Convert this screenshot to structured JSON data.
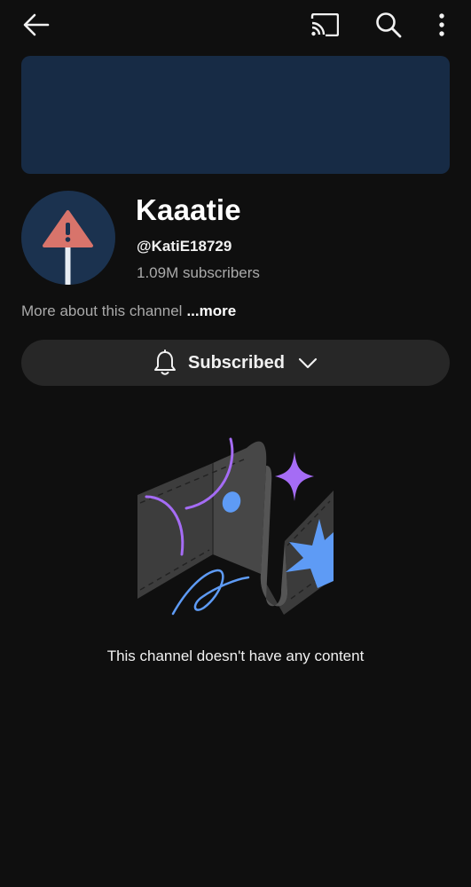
{
  "topbar": {
    "back_icon": "arrow-left-icon",
    "cast_icon": "cast-icon",
    "search_icon": "search-icon",
    "more_icon": "more-vertical-icon"
  },
  "banner": {
    "color": "#172b45"
  },
  "channel": {
    "name": "Kaaatie",
    "handle": "@KatiE18729",
    "subscribers": "1.09M subscribers",
    "avatar_icon": "warning-sign-icon"
  },
  "about": {
    "text": "More about this channel",
    "more_label": "...more"
  },
  "subscribe": {
    "label": "Subscribed",
    "bell_icon": "bell-icon",
    "chevron_icon": "chevron-down-icon"
  },
  "empty_state": {
    "illustration": "empty-channel-illustration",
    "message": "This channel doesn't have any content"
  },
  "colors": {
    "background": "#0f0f0f",
    "button_bg": "#272727",
    "accent_purple": "#a56cf5",
    "accent_blue": "#5e9bf5",
    "warning_red": "#d8746b"
  }
}
